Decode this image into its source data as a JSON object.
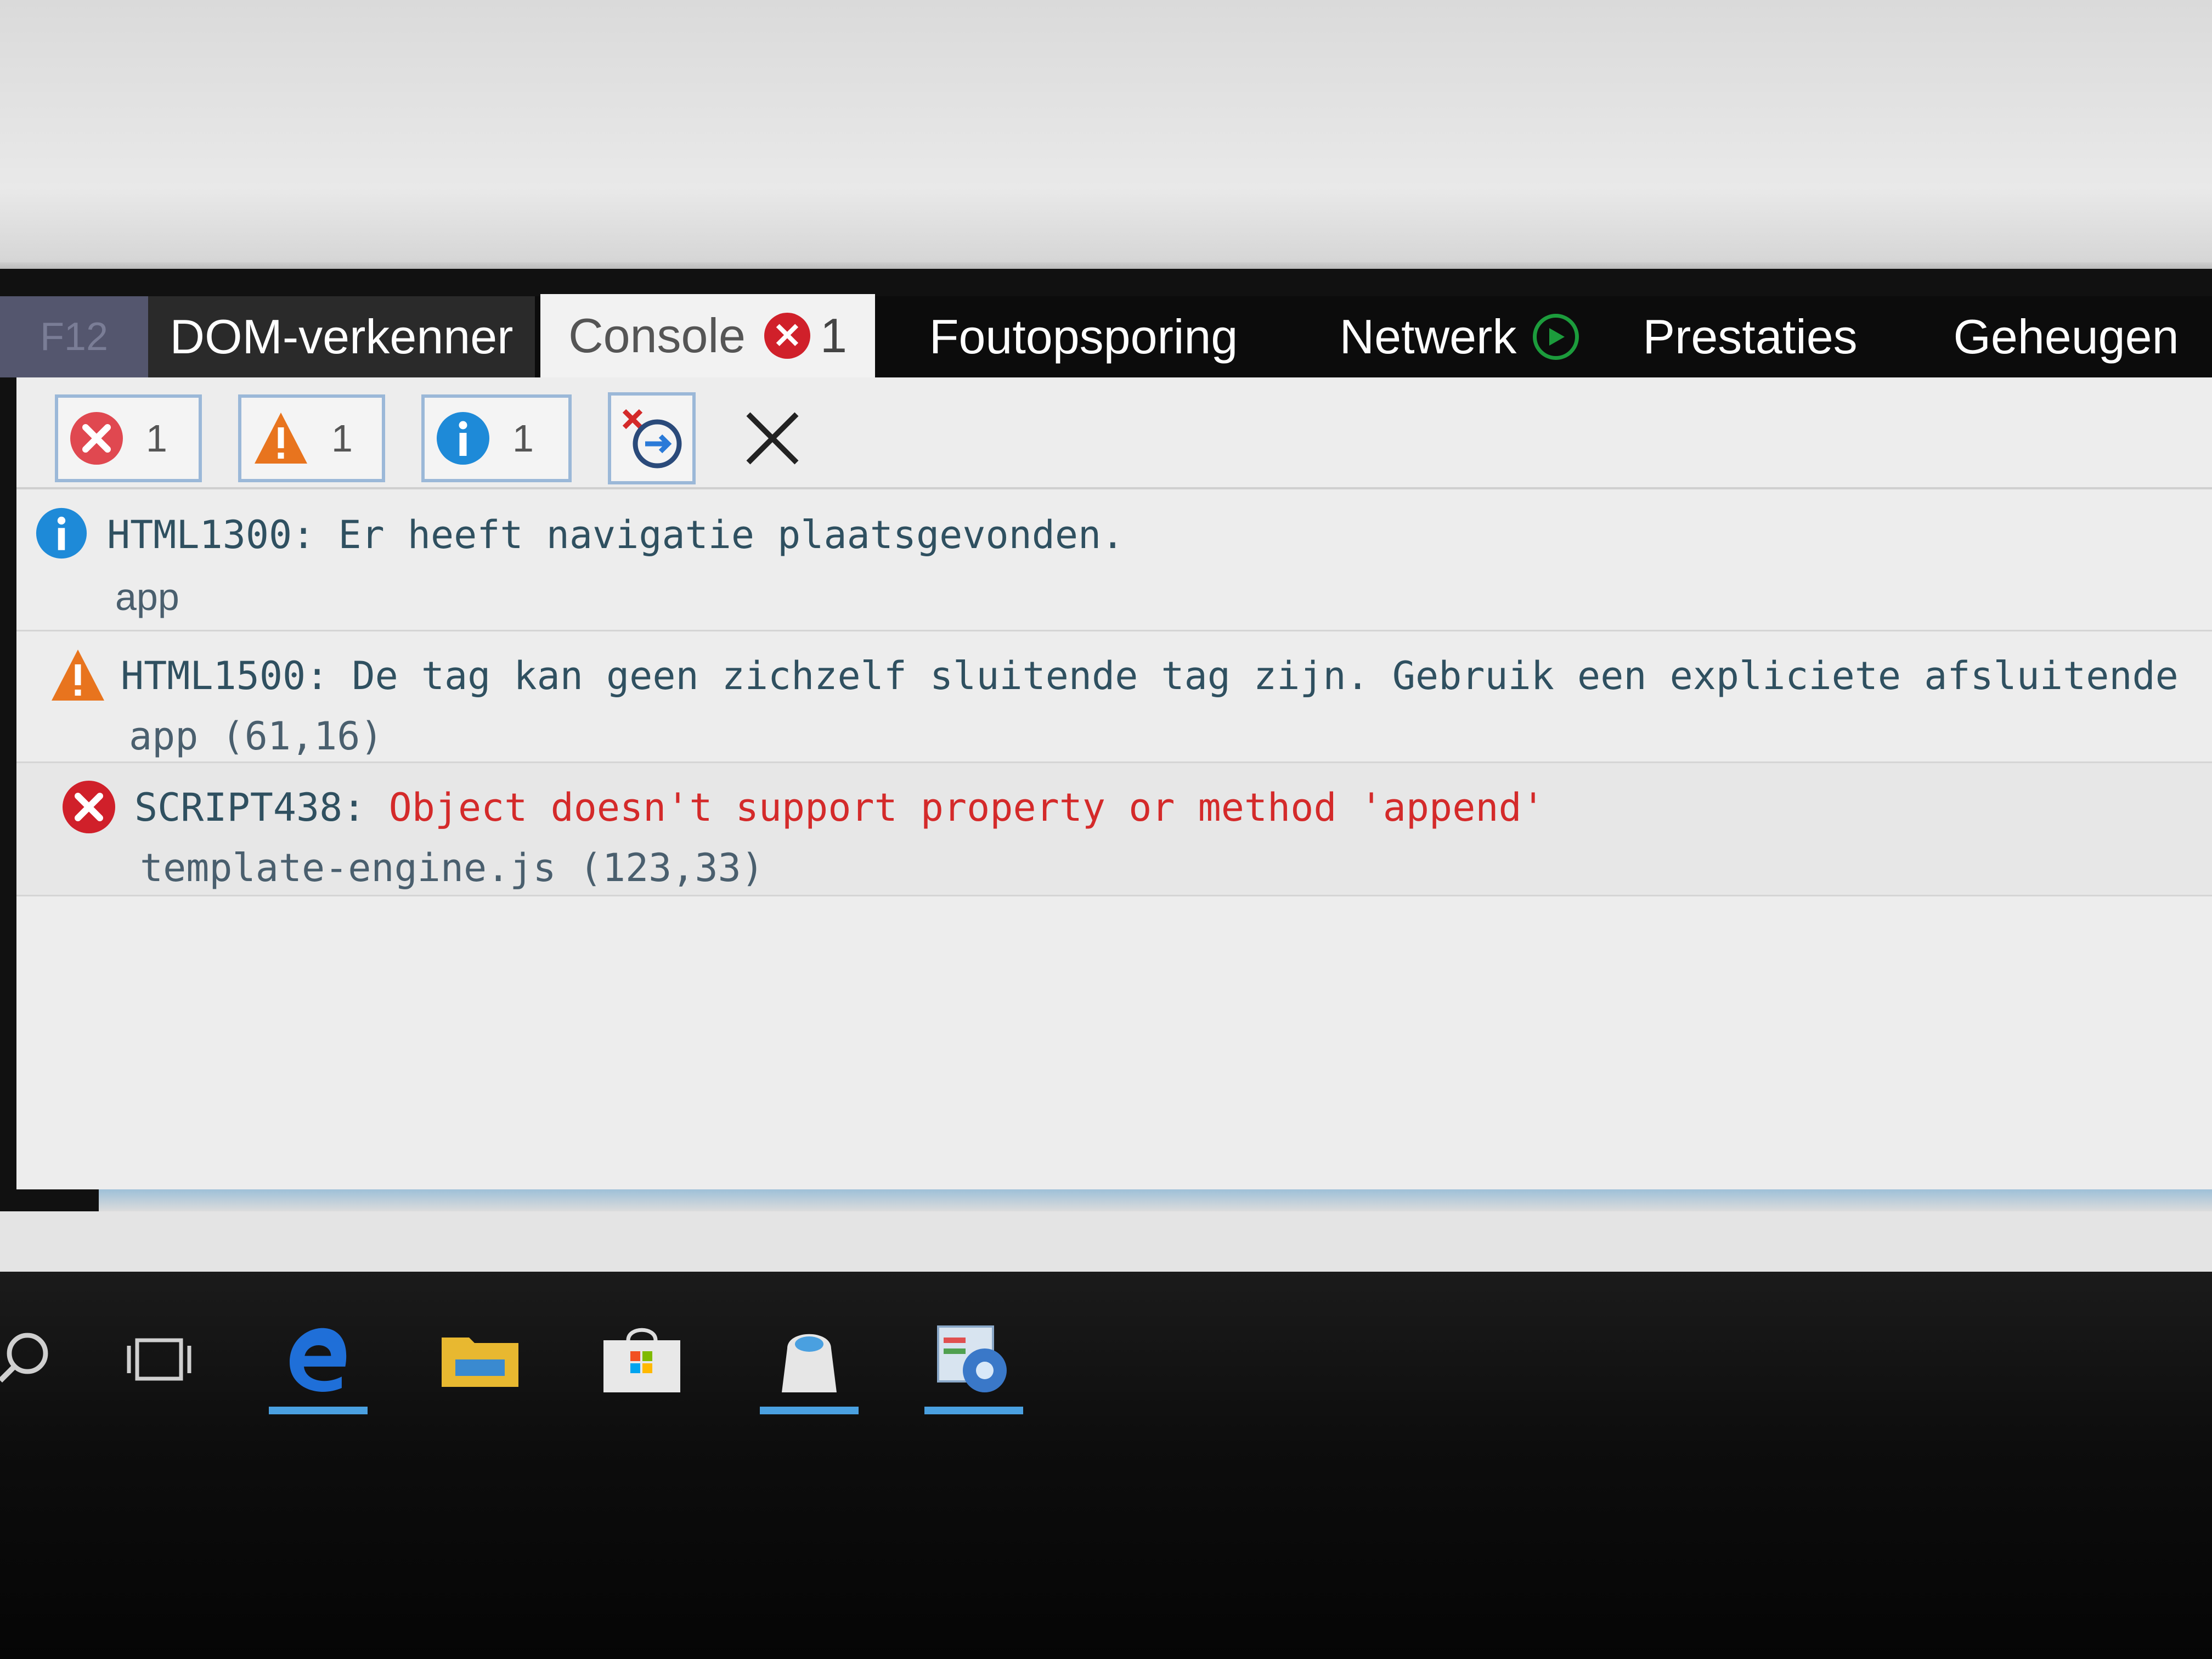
{
  "devtools": {
    "tabs": {
      "f12": "F12",
      "dom": "DOM-verkenner",
      "console": "Console",
      "console_error_count": "1",
      "debugger": "Foutopsporing",
      "network": "Netwerk",
      "performance": "Prestaties",
      "memory": "Geheugen"
    },
    "filters": {
      "errors": "1",
      "warnings": "1",
      "info": "1"
    },
    "messages": [
      {
        "type": "info",
        "code": "HTML1300:",
        "text": "Er heeft navigatie plaatsgevonden.",
        "source": "app"
      },
      {
        "type": "warning",
        "code": "HTML1500:",
        "text": "De tag kan geen zichzelf sluitende tag zijn. Gebruik een expliciete afsluitende",
        "source": "app (61,16)"
      },
      {
        "type": "error",
        "code": "SCRIPT438:",
        "text": "Object doesn't support property or method 'append'",
        "source": "template-engine.js (123,33)"
      }
    ]
  },
  "colors": {
    "error": "#d0202a",
    "warning": "#e8741e",
    "info": "#1e8ad8",
    "accent": "#9bb8d8",
    "network_green": "#1c9c3c",
    "taskbar_active": "#4aa0e0"
  },
  "taskbar": {
    "icons": [
      "search-icon",
      "task-view-icon",
      "edge-icon",
      "file-explorer-icon",
      "store-icon",
      "app-icon",
      "control-panel-icon"
    ]
  }
}
